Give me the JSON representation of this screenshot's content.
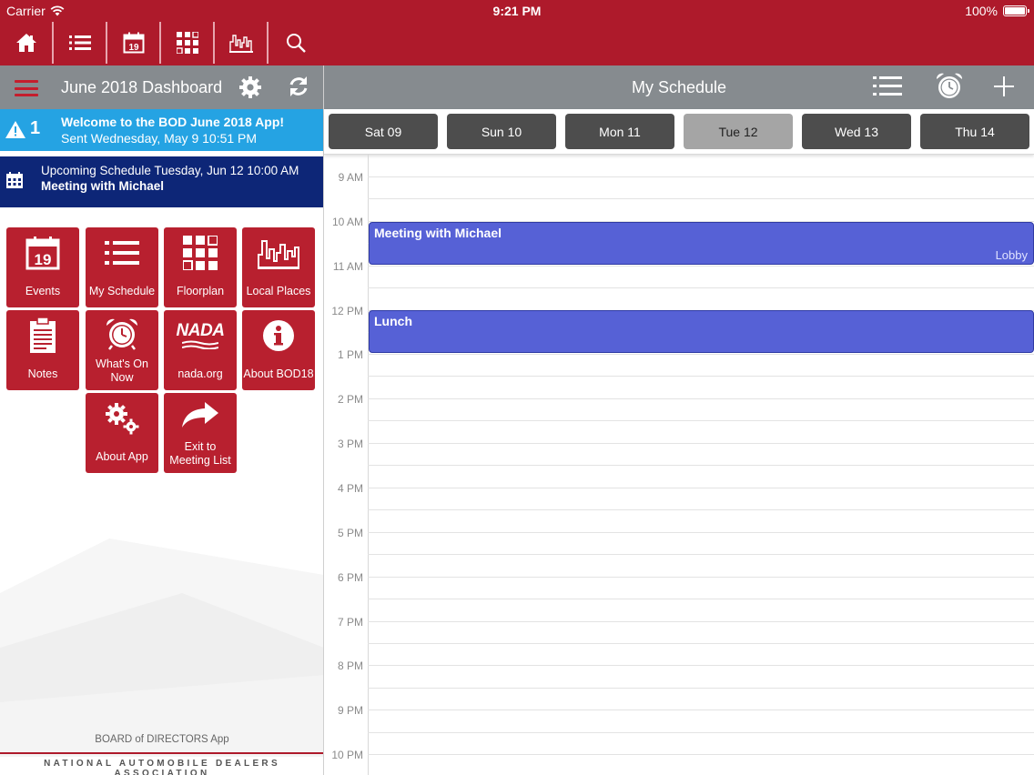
{
  "status": {
    "carrier": "Carrier",
    "time": "9:21 PM",
    "battery": "100%"
  },
  "nav_icons": [
    "home-icon",
    "list-icon",
    "calendar-icon",
    "floorplan-icon",
    "local-places-icon",
    "search-icon"
  ],
  "left": {
    "title": "June 2018 Dashboard",
    "notice": {
      "count": "1",
      "title": "Welcome to the BOD June 2018 App!",
      "sent": "Sent Wednesday, May 9 10:51 PM"
    },
    "upcoming": {
      "line1": "Upcoming Schedule Tuesday, Jun 12 10:00 AM",
      "line2": "Meeting with Michael"
    },
    "tiles": {
      "events": "Events",
      "my_schedule": "My Schedule",
      "floorplan": "Floorplan",
      "local_places": "Local Places",
      "notes": "Notes",
      "whats_on_1": "What's On",
      "whats_on_2": "Now",
      "nada": "nada.org",
      "about_bod": "About BOD18",
      "about_app": "About App",
      "exit_1": "Exit to",
      "exit_2": "Meeting List",
      "calendar_num": "19",
      "nada_logo": "NADA"
    },
    "footer_app": "BOARD of DIRECTORS App",
    "footer_org": "NATIONAL AUTOMOBILE DEALERS ASSOCIATION"
  },
  "right": {
    "title": "My Schedule",
    "days": [
      "Sat 09",
      "Sun 10",
      "Mon 11",
      "Tue 12",
      "Wed 13",
      "Thu 14"
    ],
    "active_day": "Tue 12",
    "hours": [
      "9 AM",
      "10 AM",
      "11 AM",
      "12 PM",
      "1 PM",
      "2 PM",
      "3 PM",
      "4 PM",
      "5 PM",
      "6 PM",
      "7 PM",
      "8 PM",
      "9 PM",
      "10 PM"
    ],
    "events": [
      {
        "title": "Meeting with Michael",
        "location": "Lobby"
      },
      {
        "title": "Lunch",
        "location": ""
      }
    ]
  },
  "colors": {
    "brand_red": "#ae1a2b",
    "tile_red": "#b8202f",
    "notice_blue": "#25a3e3",
    "upcoming_navy": "#0d2677",
    "event_blue": "#5661d6",
    "header_gray": "#868b8f"
  }
}
